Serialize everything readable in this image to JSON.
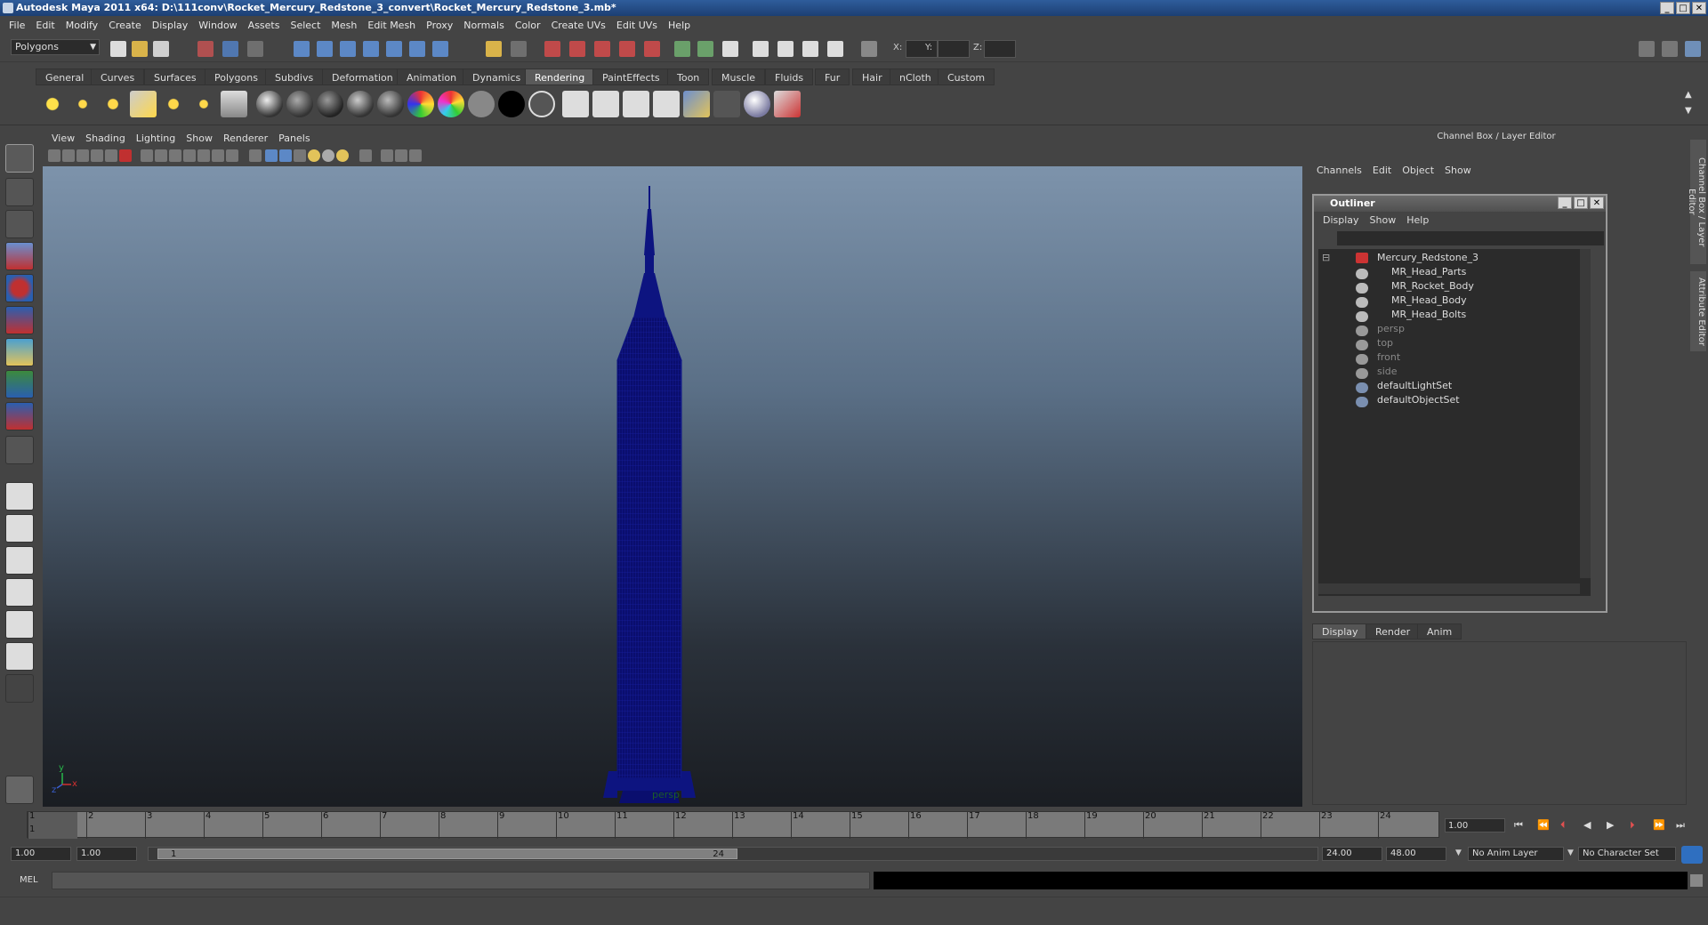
{
  "window": {
    "title": "Autodesk Maya 2011 x64: D:\\111conv\\Rocket_Mercury_Redstone_3_convert\\Rocket_Mercury_Redstone_3.mb*",
    "min": "_",
    "max": "□",
    "close": "✕"
  },
  "menubar": [
    "File",
    "Edit",
    "Modify",
    "Create",
    "Display",
    "Window",
    "Assets",
    "Select",
    "Mesh",
    "Edit Mesh",
    "Proxy",
    "Normals",
    "Color",
    "Create UVs",
    "Edit UVs",
    "Help"
  ],
  "statusline": {
    "mode": "Polygons",
    "x_label": "X:",
    "y_label": "Y:",
    "z_label": "Z:"
  },
  "shelf_tabs": [
    "General",
    "Curves",
    "Surfaces",
    "Polygons",
    "Subdivs",
    "Deformation",
    "Animation",
    "Dynamics",
    "Rendering",
    "PaintEffects",
    "Toon",
    "Muscle",
    "Fluids",
    "Fur",
    "Hair",
    "nCloth",
    "Custom"
  ],
  "active_shelf": "Rendering",
  "viewport": {
    "menu": [
      "View",
      "Shading",
      "Lighting",
      "Show",
      "Renderer",
      "Panels"
    ],
    "camera_label": "persp",
    "axis_y": "y",
    "axis_x": "x",
    "axis_z": "z"
  },
  "channelbox": {
    "header": "Channel Box / Layer Editor",
    "menu": [
      "Channels",
      "Edit",
      "Object",
      "Show"
    ],
    "layer_tabs": [
      "Display",
      "Render",
      "Anim"
    ],
    "active_layer_tab": "Display"
  },
  "outliner": {
    "title": "Outliner",
    "menu": [
      "Display",
      "Show",
      "Help"
    ],
    "items": [
      {
        "label": "Mercury_Redstone_3",
        "dim": false
      },
      {
        "label": "MR_Head_Parts",
        "dim": false
      },
      {
        "label": "MR_Rocket_Body",
        "dim": false
      },
      {
        "label": "MR_Head_Body",
        "dim": false
      },
      {
        "label": "MR_Head_Bolts",
        "dim": false
      },
      {
        "label": "persp",
        "dim": true
      },
      {
        "label": "top",
        "dim": true
      },
      {
        "label": "front",
        "dim": true
      },
      {
        "label": "side",
        "dim": true
      },
      {
        "label": "defaultLightSet",
        "dim": false
      },
      {
        "label": "defaultObjectSet",
        "dim": false
      }
    ]
  },
  "side_tabs": [
    "Channel Box / Layer Editor",
    "Attribute Editor"
  ],
  "timeline": {
    "ticks": [
      "1",
      "2",
      "3",
      "4",
      "5",
      "6",
      "7",
      "8",
      "9",
      "10",
      "11",
      "12",
      "13",
      "14",
      "15",
      "16",
      "17",
      "18",
      "19",
      "20",
      "21",
      "22",
      "23",
      "24"
    ],
    "current_marker": "1",
    "current_frame": "1.00"
  },
  "range": {
    "start": "1.00",
    "anim_start": "1.00",
    "slider_start": "1",
    "slider_end": "24",
    "end": "24.00",
    "anim_end": "48.00",
    "anim_layer": "No Anim Layer",
    "character_set": "No Character Set"
  },
  "cmdline": {
    "mode": "MEL"
  }
}
